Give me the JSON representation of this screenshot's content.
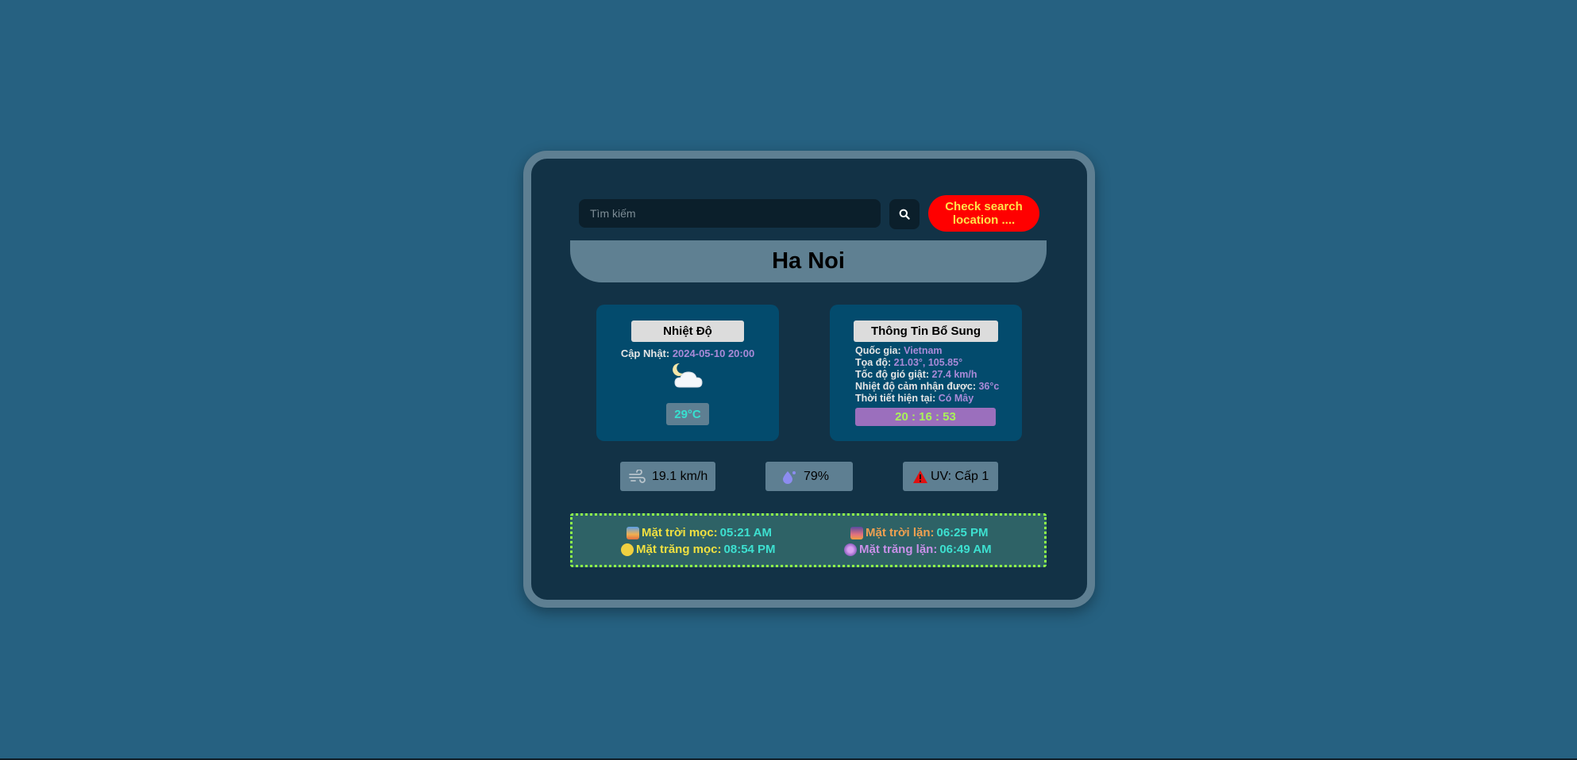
{
  "search": {
    "placeholder": "Tìm kiếm",
    "button_icon": "search-icon",
    "check_button_label": "Check search location ...."
  },
  "city": {
    "name": "Ha Noi"
  },
  "temperature_panel": {
    "title": "Nhiệt Độ",
    "update_label": "Cập Nhật:",
    "update_value": "2024-05-10 20:00",
    "weather_icon": "moon-cloud-icon",
    "temperature": "29°C"
  },
  "info_panel": {
    "title": "Thông Tin Bổ Sung",
    "country_label": "Quốc gia:",
    "country_value": "Vietnam",
    "coords_label": "Tọa độ:",
    "coords_value": "21.03°, 105.85°",
    "gust_label": "Tốc độ gió giật:",
    "gust_value": "27.4 km/h",
    "feels_label": "Nhiệt độ cảm nhận được:",
    "feels_value": "36°c",
    "condition_label": "Thời tiết hiện tại:",
    "condition_value": "Có Mây",
    "clock": "20 : 16 : 53"
  },
  "stats": {
    "wind": "19.1 km/h",
    "humidity": "79%",
    "uv": "UV: Cấp 1"
  },
  "astro": {
    "sunrise_label": "Mặt trời mọc:",
    "sunrise_value": "05:21 AM",
    "sunset_label": "Mặt trời lặn:",
    "sunset_value": "06:25 PM",
    "moonrise_label": "Mặt trăng mọc:",
    "moonrise_value": "08:54 PM",
    "moonset_label": "Mặt trăng lặn:",
    "moonset_value": "06:49 AM"
  },
  "colors": {
    "background": "#266181",
    "card": "#123246",
    "card_border": "#5e7f92",
    "check_button": "#ff0000",
    "accent_violet": "#a98ad8",
    "accent_cyan": "#3de0d0"
  }
}
